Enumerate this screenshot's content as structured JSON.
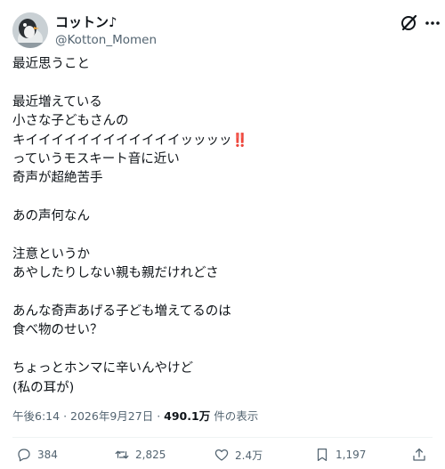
{
  "author": {
    "display_name": "コットン♪",
    "handle": "@Kotton_Momen"
  },
  "icons": {
    "avatar": "penguin-avatar",
    "grok": "grok-icon",
    "more": "more-icon",
    "reply": "reply-icon",
    "repost": "repost-icon",
    "like": "heart-icon",
    "bookmark": "bookmark-icon",
    "share": "share-icon"
  },
  "post": {
    "lines": [
      "最近思うこと",
      "",
      "最近増えている",
      "小さな子どもさんの",
      "キイイイイイイイイイイイイッッッッ",
      "っていうモスキート音に近い",
      "奇声が超絶苦手",
      "",
      "あの声何なん",
      "",
      "注意というか",
      "あやしたりしない親も親だけれどさ",
      "",
      "あんな奇声あげる子ども増えてるのは",
      "食べ物のせい？",
      "",
      "ちょっとホンマに辛いんやけど",
      "(私の耳が)"
    ],
    "emphasis": "‼️"
  },
  "meta": {
    "time": "午後6:14",
    "separator": "·",
    "date": "2026年9月27日",
    "views_count": "490.1万",
    "views_label": "件の表示"
  },
  "actions": {
    "replies": "384",
    "reposts": "2,825",
    "likes": "2.4万",
    "bookmarks": "1,197"
  },
  "colors": {
    "text": "#0f1419",
    "secondary": "#536471",
    "divider": "#eff3f4",
    "emphasis": "#d4282b"
  }
}
